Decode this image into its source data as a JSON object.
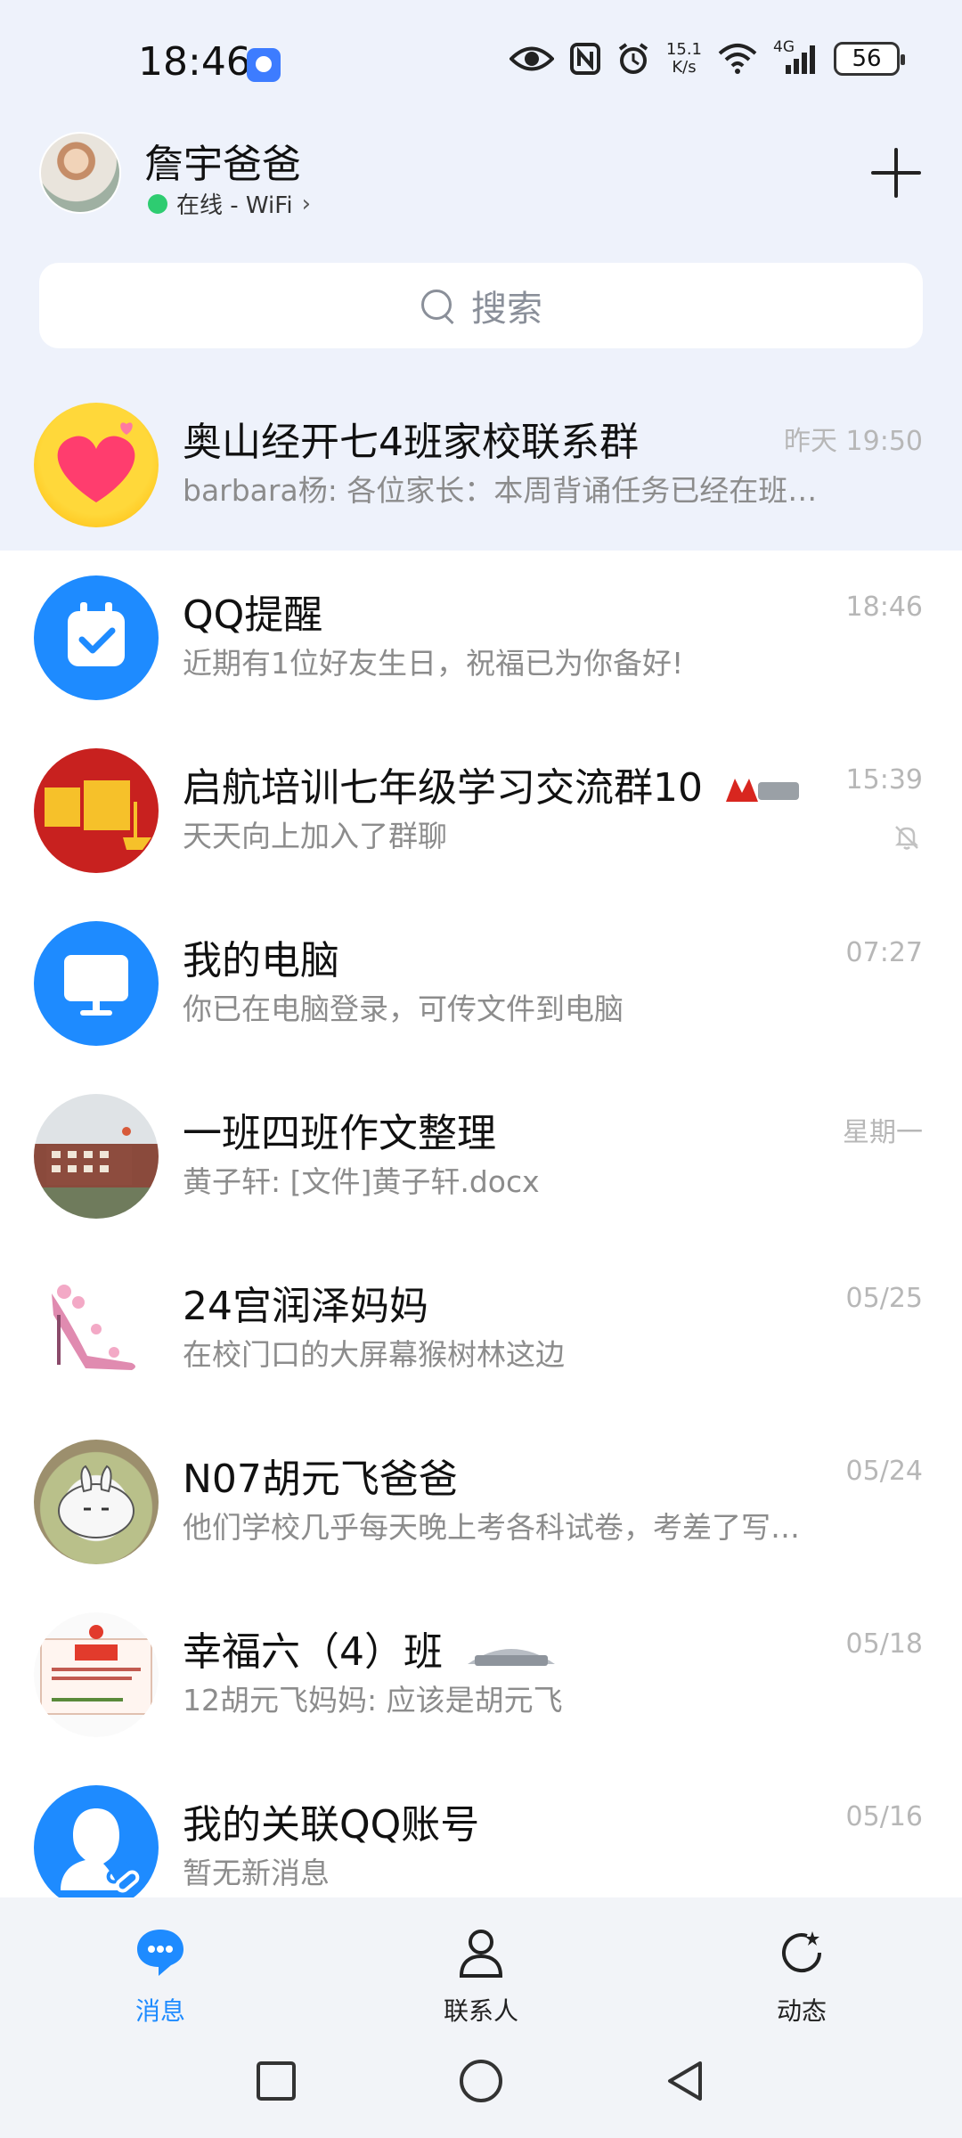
{
  "status_bar": {
    "time": "18:46",
    "net_speed_value": "15.1",
    "net_speed_unit": "K/s",
    "signal_label": "4G",
    "battery": "56",
    "icons": [
      "eye-icon",
      "nfc-icon",
      "alarm-icon",
      "wifi-icon",
      "signal-icon"
    ]
  },
  "header": {
    "name": "詹宇爸爸",
    "status": "在线 - WiFi",
    "chevron": "›"
  },
  "search": {
    "placeholder": "搜索"
  },
  "chats": [
    {
      "title": "奥山经开七4班家校联系群",
      "preview": "barbara杨: 各位家长：本周背诵任务已经在班…",
      "time": "昨天 19:50",
      "pinned": true
    },
    {
      "title": "QQ提醒",
      "preview": "近期有1位好友生日，祝福已为你备好!",
      "time": "18:46"
    },
    {
      "title": "启航培训七年级学习交流群10",
      "preview": "天天向上加入了群聊",
      "time": "15:39",
      "muted": true
    },
    {
      "title": "我的电脑",
      "preview": "你已在电脑登录，可传文件到电脑",
      "time": "07:27"
    },
    {
      "title": "一班四班作文整理",
      "preview": "黄子轩: [文件]黄子轩.docx",
      "time": "星期一"
    },
    {
      "title": "24宫润泽妈妈",
      "preview": "在校门口的大屏幕猴树林这边",
      "time": "05/25"
    },
    {
      "title": "N07胡元飞爸爸",
      "preview": "他们学校几乎每天晚上考各科试卷，考差了写…",
      "time": "05/24"
    },
    {
      "title": "幸福六（4）班",
      "preview": "12胡元飞妈妈: 应该是胡元飞",
      "time": "05/18"
    },
    {
      "title": "我的关联QQ账号",
      "preview": "暂无新消息",
      "time": "05/16"
    }
  ],
  "nav": {
    "tabs": [
      {
        "label": "消息",
        "active": true
      },
      {
        "label": "联系人",
        "active": false
      },
      {
        "label": "动态",
        "active": false
      }
    ]
  },
  "colors": {
    "accent": "#1e8bff",
    "top_bg": "#eef2fb",
    "online": "#2ecc71"
  }
}
